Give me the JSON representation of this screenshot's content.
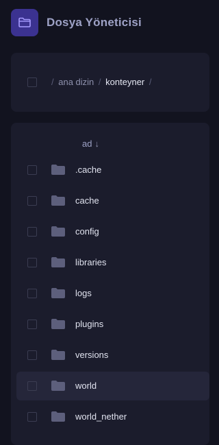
{
  "app": {
    "title": "Dosya Yöneticisi",
    "logo_icon": "folder-outline-icon",
    "accent": "#3b3290"
  },
  "breadcrumb": {
    "items": [
      {
        "label": "ana dizin"
      },
      {
        "label": "konteyner"
      }
    ],
    "separator": "/"
  },
  "list": {
    "column_label": "ad",
    "sort_indicator": "↓",
    "rows": [
      {
        "name": ".cache",
        "icon": "folder-icon"
      },
      {
        "name": "cache",
        "icon": "folder-icon"
      },
      {
        "name": "config",
        "icon": "folder-icon"
      },
      {
        "name": "libraries",
        "icon": "folder-icon"
      },
      {
        "name": "logs",
        "icon": "folder-icon"
      },
      {
        "name": "plugins",
        "icon": "folder-icon"
      },
      {
        "name": "versions",
        "icon": "folder-icon"
      },
      {
        "name": "world",
        "icon": "folder-icon",
        "hovered": true
      },
      {
        "name": "world_nether",
        "icon": "folder-icon"
      }
    ]
  }
}
